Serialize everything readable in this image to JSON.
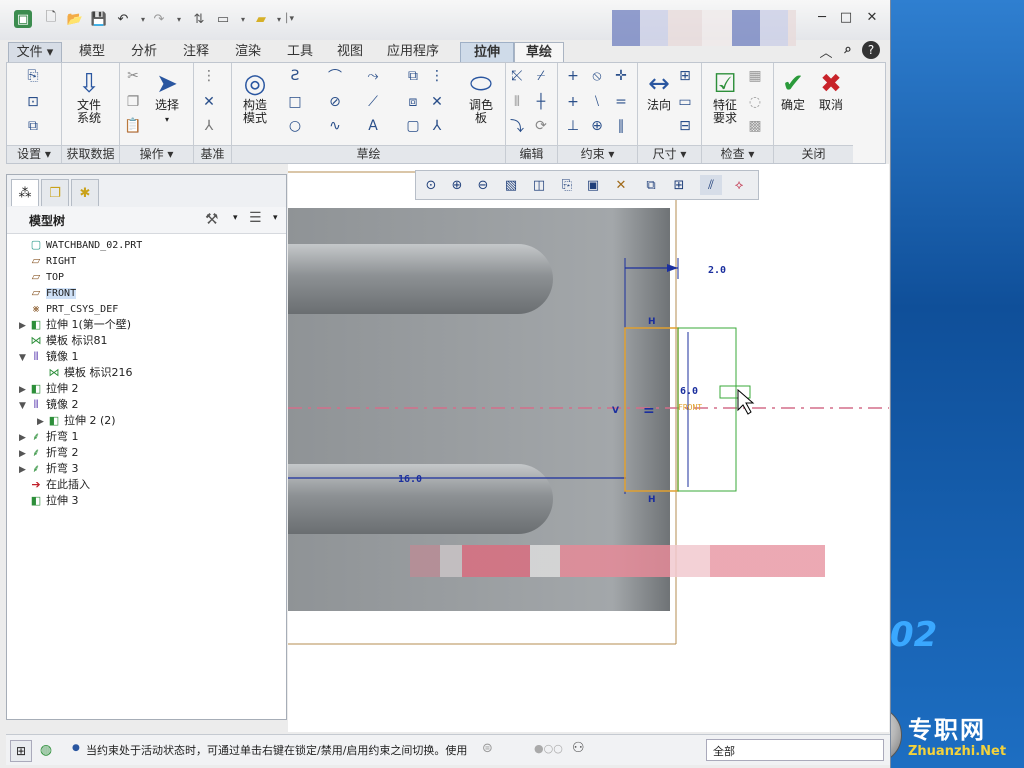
{
  "quickbar": {
    "icons": [
      "new-icon",
      "open-icon",
      "save-icon",
      "undo-icon",
      "redo-icon",
      "regenerate-icon",
      "window-icon",
      "folder-icon",
      "customize-icon"
    ]
  },
  "window_controls": {
    "min": "─",
    "max": "□",
    "close": "✕",
    "help": "?"
  },
  "tabs": [
    {
      "label": "文件 ▾"
    },
    {
      "label": "模型"
    },
    {
      "label": "分析"
    },
    {
      "label": "注释"
    },
    {
      "label": "渲染"
    },
    {
      "label": "工具"
    },
    {
      "label": "视图"
    },
    {
      "label": "应用程序"
    },
    {
      "label": "拉伸"
    },
    {
      "label": "草绘"
    }
  ],
  "ribbon": {
    "file_system": "文件\n系统",
    "select": "选择",
    "construct_mode": "构造\n模式",
    "palette": "调色\n板",
    "normal": "法向",
    "feature_req": "特征\n要求",
    "ok": "确定",
    "cancel": "取消",
    "groups": [
      "设置 ▾",
      "获取数据",
      "操作 ▾",
      "基准",
      "草绘",
      "编辑",
      "约束 ▾",
      "尺寸 ▾",
      "检查 ▾",
      "关闭"
    ]
  },
  "panel": {
    "title": "模型树",
    "items": [
      {
        "label": "WATCHBAND_02.PRT",
        "icon": "part-icon",
        "mono": true
      },
      {
        "label": "RIGHT",
        "icon": "datum-plane-icon",
        "mono": true
      },
      {
        "label": "TOP",
        "icon": "datum-plane-icon",
        "mono": true
      },
      {
        "label": "FRONT",
        "icon": "datum-plane-icon",
        "mono": true,
        "selected": true
      },
      {
        "label": "PRT_CSYS_DEF",
        "icon": "csys-icon",
        "mono": true
      },
      {
        "label": "拉伸 1(第一个壁)",
        "icon": "extrude-icon",
        "expand": "▶"
      },
      {
        "label": "模板 标识81",
        "icon": "template-icon"
      },
      {
        "label": "镜像 1",
        "icon": "mirror-icon",
        "expand": "▼"
      },
      {
        "label": "模板 标识216",
        "icon": "template-icon",
        "indent": true
      },
      {
        "label": "拉伸 2",
        "icon": "extrude-icon",
        "expand": "▶"
      },
      {
        "label": "镜像 2",
        "icon": "mirror-icon",
        "expand": "▼"
      },
      {
        "label": "拉伸 2 (2)",
        "icon": "extrude-icon",
        "expand": "▶",
        "indent": true
      },
      {
        "label": "折弯 1",
        "icon": "bend-icon",
        "expand": "▶"
      },
      {
        "label": "折弯 2",
        "icon": "bend-icon",
        "expand": "▶"
      },
      {
        "label": "折弯 3",
        "icon": "bend-icon",
        "expand": "▶"
      },
      {
        "label": "在此插入",
        "icon": "insert-arrow-icon"
      },
      {
        "label": "拉伸 3",
        "icon": "extrude-icon"
      }
    ]
  },
  "sketch": {
    "dim_top": "2.0",
    "dim_bottom": "16.0",
    "dim_mid": "6.0",
    "label_h": "H",
    "label_v": "V",
    "label_front": "FRONT"
  },
  "status": {
    "message": "当约束处于活动状态时，可通过单击右键在锁定/禁用/启用约束之间切换。使用",
    "filter": "全部"
  },
  "watermark": {
    "text": "专职网",
    "url": "Zhuanzhi.Net",
    "big": "02"
  },
  "colors": {
    "accent": "#2a56a0",
    "dimension": "#1b2f9e",
    "sketch_orange": "#e0a030",
    "sketch_green": "#3aa83a"
  }
}
